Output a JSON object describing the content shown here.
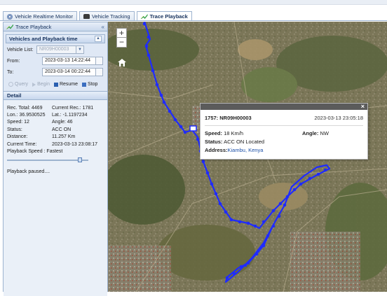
{
  "tabs": [
    {
      "label": "Vehicle Realtime Monitor",
      "icon": "monitor-icon"
    },
    {
      "label": "Vehicle Tracking",
      "icon": "car-icon"
    },
    {
      "label": "Trace Playback",
      "icon": "trace-icon",
      "active": true
    }
  ],
  "panel": {
    "title": "Trace Playback",
    "collapse_glyph": "«",
    "section_title": "Vehicles and Playback time",
    "section_toggle": "▲",
    "vehicle_list_label": "Vehicle List:",
    "vehicle_list_value": "NR09H00003",
    "from_label": "From:",
    "from_value": "2023-03-13 14:22:44",
    "to_label": "To:",
    "to_value": "2023-03-14 00:22:44",
    "buttons": {
      "query": "Query",
      "begin": "Begin",
      "resume": "Resume",
      "stop": "Stop"
    },
    "detail_title": "Detail",
    "detail": {
      "rec_total": "Rec. Total: 4469",
      "current_rec": "Current Rec.: 1781",
      "lon": "Lon.: 36.9530525",
      "lat": "Lat.: -1.1197234",
      "speed": "Speed: 12",
      "angle": "Angle: 46",
      "status_label": "Status:",
      "status_value": "ACC ON",
      "distance_label": "Distance:",
      "distance_value": "11.257 Km",
      "current_time_label": "Current Time:",
      "current_time_value": "2023-03-13 23:08:17",
      "playback_speed": "Playback Speed :  Fastest",
      "playback_speed_level": 0.92,
      "status_message": "Playback paused...."
    }
  },
  "map": {
    "zoom_in": "+",
    "zoom_out": "−",
    "route_color": "#1f2bff",
    "popup": {
      "close": "×",
      "title": "1757: NR09H00003",
      "timestamp": "2023-03-13 23:05:18",
      "speed_label": "Speed:",
      "speed_value": "18 Km/h",
      "angle_label": "Angle:",
      "angle_value": "NW",
      "status_label": "Status:",
      "status_value": "ACC ON Located",
      "address_label": "Address:",
      "address_value": "Kiambu, Kenya"
    }
  },
  "colors": {
    "panel_bg": "#dfe8f5",
    "header_text": "#15305b",
    "address_link": "#1b4fa8"
  }
}
